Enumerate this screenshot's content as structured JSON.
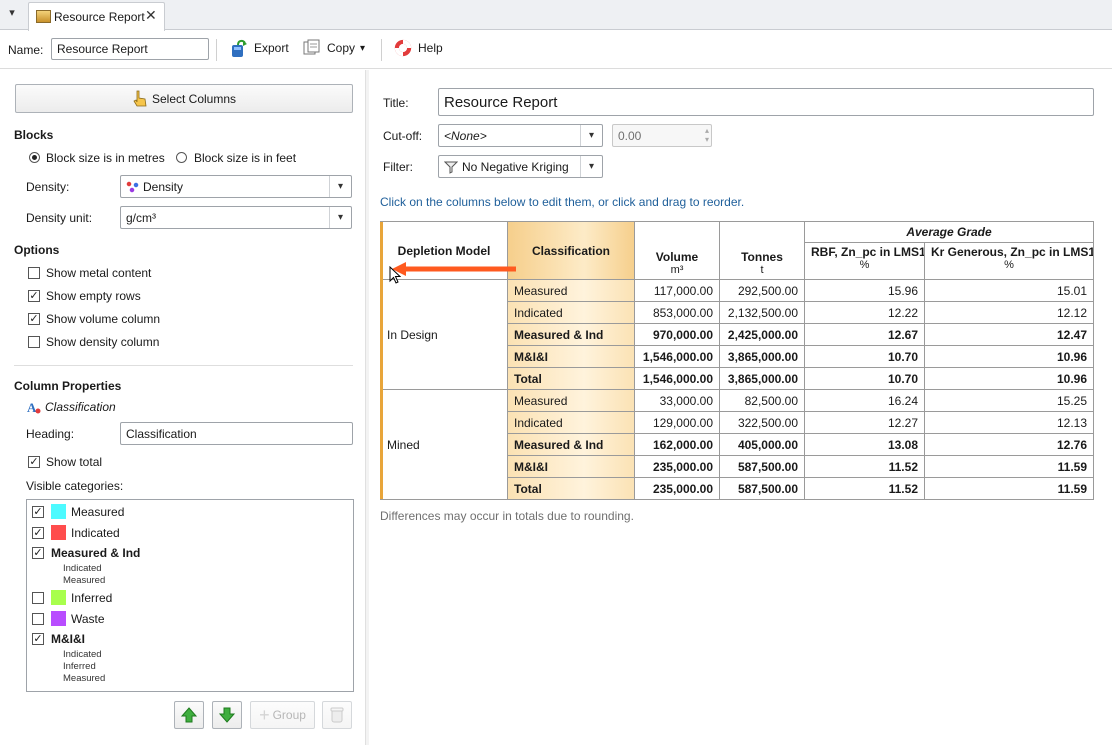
{
  "tab": {
    "title": "Resource Report",
    "close": "✕"
  },
  "toolbar": {
    "name_label": "Name:",
    "name_value": "Resource Report",
    "export": "Export",
    "copy": "Copy",
    "help": "Help"
  },
  "left": {
    "select_columns": "Select Columns",
    "blocks": {
      "heading": "Blocks",
      "radio_metres": "Block size is in metres",
      "radio_feet": "Block size is in feet",
      "selected": "metres",
      "density_label": "Density:",
      "density_value": "Density",
      "density_unit_label": "Density unit:",
      "density_unit_value": "g/cm³"
    },
    "options": {
      "heading": "Options",
      "items": [
        {
          "label": "Show metal content",
          "checked": false
        },
        {
          "label": "Show empty rows",
          "checked": true
        },
        {
          "label": "Show volume column",
          "checked": true
        },
        {
          "label": "Show density column",
          "checked": false
        }
      ]
    },
    "colprops": {
      "heading": "Column Properties",
      "column_name": "Classification",
      "heading_label": "Heading:",
      "heading_value": "Classification",
      "show_total": "Show total",
      "visible_label": "Visible categories:"
    },
    "categories": [
      {
        "label": "Measured",
        "checked": true,
        "color": "#4dfaff",
        "bold": false,
        "subs": []
      },
      {
        "label": "Indicated",
        "checked": true,
        "color": "#ff4d4d",
        "bold": false,
        "subs": []
      },
      {
        "label": "Measured & Ind",
        "checked": true,
        "color": "",
        "bold": true,
        "subs": [
          "Indicated",
          "Measured"
        ]
      },
      {
        "label": "Inferred",
        "checked": false,
        "color": "#a8ff4d",
        "bold": false,
        "subs": []
      },
      {
        "label": "Waste",
        "checked": false,
        "color": "#b84dff",
        "bold": false,
        "subs": []
      },
      {
        "label": "M&I&I",
        "checked": true,
        "color": "",
        "bold": true,
        "subs": [
          "Indicated",
          "Inferred",
          "Measured"
        ]
      }
    ],
    "group_label": "Group"
  },
  "right": {
    "title_label": "Title:",
    "title_value": "Resource Report",
    "cutoff_label": "Cut-off:",
    "cutoff_value": "<None>",
    "cutoff_number": "0.00",
    "filter_label": "Filter:",
    "filter_value": "No Negative Kriging",
    "hint": "Click on the columns below to edit them, or click and drag to reorder.",
    "footnote": "Differences may occur in totals due to rounding."
  },
  "report": {
    "group_header": "Average Grade",
    "columns": {
      "depletion": "Depletion Model",
      "classification": "Classification",
      "volume": "Volume",
      "volume_unit": "m³",
      "tonnes": "Tonnes",
      "tonnes_unit": "t",
      "rbf": "RBF, Zn_pc in LMS1",
      "rbf_unit": "%",
      "kr": "Kr Generous, Zn_pc in LMS1",
      "kr_unit": "%"
    },
    "groups": [
      {
        "model": "In Design",
        "rows": [
          {
            "cls": "Measured",
            "vol": "117,000.00",
            "ton": "292,500.00",
            "rbf": "15.96",
            "kr": "15.01",
            "bold": false
          },
          {
            "cls": "Indicated",
            "vol": "853,000.00",
            "ton": "2,132,500.00",
            "rbf": "12.22",
            "kr": "12.12",
            "bold": false
          },
          {
            "cls": "Measured & Ind",
            "vol": "970,000.00",
            "ton": "2,425,000.00",
            "rbf": "12.67",
            "kr": "12.47",
            "bold": true
          },
          {
            "cls": "M&I&I",
            "vol": "1,546,000.00",
            "ton": "3,865,000.00",
            "rbf": "10.70",
            "kr": "10.96",
            "bold": true
          },
          {
            "cls": "Total",
            "vol": "1,546,000.00",
            "ton": "3,865,000.00",
            "rbf": "10.70",
            "kr": "10.96",
            "bold": true
          }
        ]
      },
      {
        "model": "Mined",
        "rows": [
          {
            "cls": "Measured",
            "vol": "33,000.00",
            "ton": "82,500.00",
            "rbf": "16.24",
            "kr": "15.25",
            "bold": false
          },
          {
            "cls": "Indicated",
            "vol": "129,000.00",
            "ton": "322,500.00",
            "rbf": "12.27",
            "kr": "12.13",
            "bold": false
          },
          {
            "cls": "Measured & Ind",
            "vol": "162,000.00",
            "ton": "405,000.00",
            "rbf": "13.08",
            "kr": "12.76",
            "bold": true
          },
          {
            "cls": "M&I&I",
            "vol": "235,000.00",
            "ton": "587,500.00",
            "rbf": "11.52",
            "kr": "11.59",
            "bold": true
          },
          {
            "cls": "Total",
            "vol": "235,000.00",
            "ton": "587,500.00",
            "rbf": "11.52",
            "kr": "11.59",
            "bold": true
          }
        ]
      }
    ]
  },
  "colors": {
    "accent": "#e8a53a",
    "arrow": "#ff5a1f",
    "link": "#1f5f9a"
  }
}
